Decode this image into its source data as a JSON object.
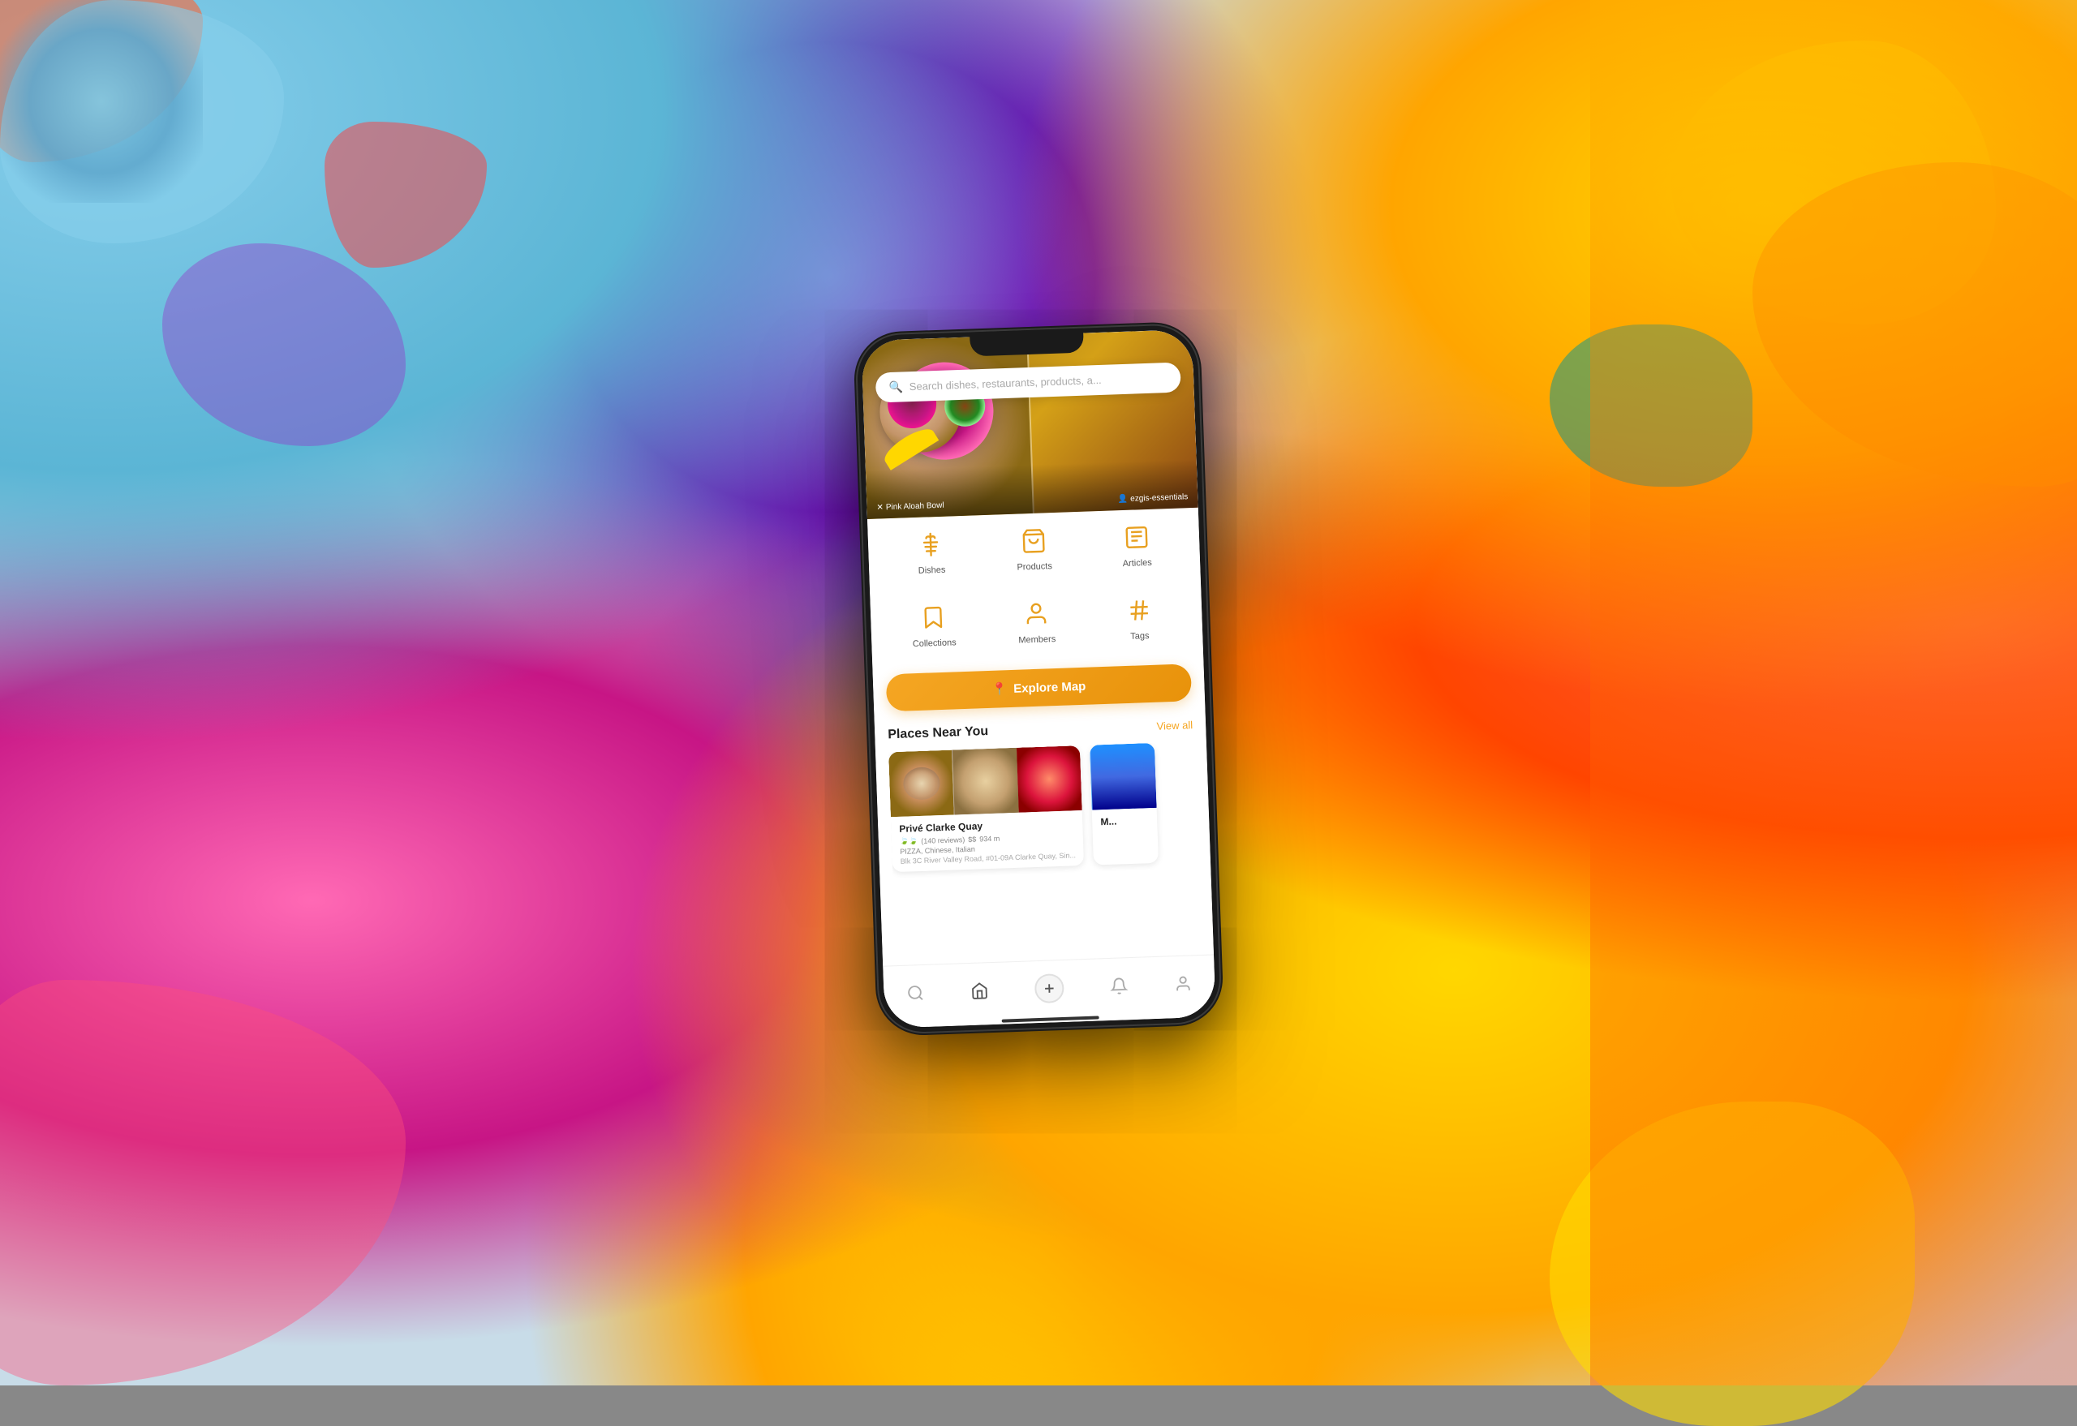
{
  "background": {
    "alt": "Colorful graffiti wall background"
  },
  "phone": {
    "hero": {
      "left_label": "Pink Aloah Bowl",
      "right_label": "ezgis-essentials",
      "left_icon": "✕",
      "right_icon": "👤"
    },
    "search": {
      "placeholder": "Search dishes, restaurants, products, a..."
    },
    "categories": [
      {
        "id": "dishes",
        "label": "Dishes",
        "icon": "fork-knife"
      },
      {
        "id": "products",
        "label": "Products",
        "icon": "cart"
      },
      {
        "id": "articles",
        "label": "Articles",
        "icon": "newspaper"
      },
      {
        "id": "collections",
        "label": "Collections",
        "icon": "bookmark"
      },
      {
        "id": "members",
        "label": "Members",
        "icon": "person"
      },
      {
        "id": "tags",
        "label": "Tags",
        "icon": "hashtag"
      }
    ],
    "explore_map_btn": "Explore Map",
    "places_section": {
      "title": "Places Near You",
      "view_all": "View all",
      "places": [
        {
          "name": "Privé Clarke Quay",
          "cuisine": "PIZZA, Chinese, Italian",
          "rating": "🍃🍃",
          "reviews": "(140 reviews)",
          "price": "$$",
          "distance": "934 m",
          "address": "Blk 3C River Valley Road, #01-09A Clarke Quay, Sin..."
        },
        {
          "name": "M...",
          "cuisine": "",
          "rating": "",
          "reviews": "",
          "price": "",
          "distance": "",
          "address": ""
        }
      ]
    },
    "bottom_nav": [
      {
        "id": "search",
        "icon": "search",
        "active": false
      },
      {
        "id": "home",
        "icon": "home",
        "active": true
      },
      {
        "id": "add",
        "icon": "plus",
        "active": false
      },
      {
        "id": "notifications",
        "icon": "bell",
        "active": false
      },
      {
        "id": "profile",
        "icon": "person",
        "active": false
      }
    ]
  }
}
